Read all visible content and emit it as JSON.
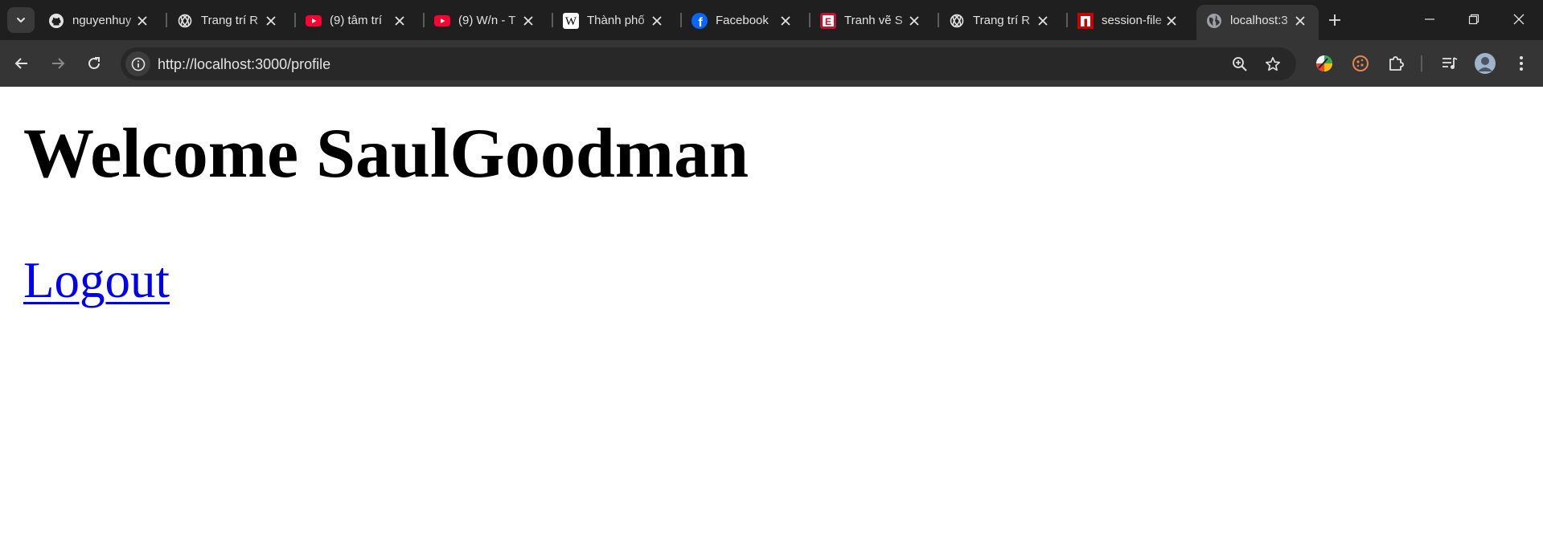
{
  "browser": {
    "tabs": [
      {
        "label": "nguyenhuy",
        "icon": "github-icon"
      },
      {
        "label": "Trang trí R",
        "icon": "chatgpt-icon"
      },
      {
        "label": "(9) tâm trí",
        "icon": "youtube-icon"
      },
      {
        "label": "(9) W/n - T",
        "icon": "youtube-icon"
      },
      {
        "label": "Thành phố",
        "icon": "wikipedia-icon"
      },
      {
        "label": "Facebook",
        "icon": "facebook-icon"
      },
      {
        "label": "Tranh vẽ S",
        "icon": "e-site-icon"
      },
      {
        "label": "Trang trí R",
        "icon": "chatgpt-icon"
      },
      {
        "label": "session-file",
        "icon": "npm-icon"
      },
      {
        "label": "localhost:3",
        "icon": "globe-icon",
        "active": true
      }
    ],
    "url": "http://localhost:3000/profile",
    "colors": {
      "tabstrip": "#1f1f1f",
      "toolbar": "#353535",
      "omnibox": "#282828",
      "text": "#e3e3e3"
    }
  },
  "page": {
    "heading": "Welcome SaulGoodman",
    "logout_label": "Logout",
    "link_color": "#0000ee"
  }
}
